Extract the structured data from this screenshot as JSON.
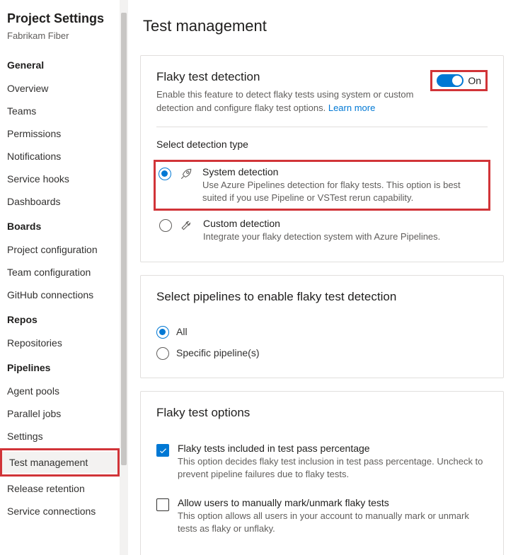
{
  "sidebar": {
    "title": "Project Settings",
    "subtitle": "Fabrikam Fiber",
    "sections": [
      {
        "header": "General",
        "items": [
          "Overview",
          "Teams",
          "Permissions",
          "Notifications",
          "Service hooks",
          "Dashboards"
        ]
      },
      {
        "header": "Boards",
        "items": [
          "Project configuration",
          "Team configuration",
          "GitHub connections"
        ]
      },
      {
        "header": "Repos",
        "items": [
          "Repositories"
        ]
      },
      {
        "header": "Pipelines",
        "items": [
          "Agent pools",
          "Parallel jobs",
          "Settings",
          "Test management",
          "Release retention",
          "Service connections"
        ]
      }
    ],
    "active_item": "Test management"
  },
  "main": {
    "title": "Test management",
    "flaky_detection": {
      "title": "Flaky test detection",
      "description": "Enable this feature to detect flaky tests using system or custom detection and configure flaky test options.",
      "learn_more": "Learn more",
      "toggle_state": "On",
      "detection_section_label": "Select detection type",
      "options": [
        {
          "selected": true,
          "title": "System detection",
          "desc": "Use Azure Pipelines detection for flaky tests. This option is best suited if you use Pipeline or VSTest rerun capability."
        },
        {
          "selected": false,
          "title": "Custom detection",
          "desc": "Integrate your flaky detection system with Azure Pipelines."
        }
      ]
    },
    "pipelines_section": {
      "title": "Select pipelines to enable flaky test detection",
      "options": [
        {
          "label": "All",
          "selected": true
        },
        {
          "label": "Specific pipeline(s)",
          "selected": false
        }
      ]
    },
    "options_section": {
      "title": "Flaky test options",
      "checkboxes": [
        {
          "checked": true,
          "title": "Flaky tests included in test pass percentage",
          "desc": "This option decides flaky test inclusion in test pass percentage. Uncheck to prevent pipeline failures due to flaky tests."
        },
        {
          "checked": false,
          "title": "Allow users to manually mark/unmark flaky tests",
          "desc": "This option allows all users in your account to manually mark or unmark tests as flaky or unflaky."
        }
      ]
    }
  }
}
